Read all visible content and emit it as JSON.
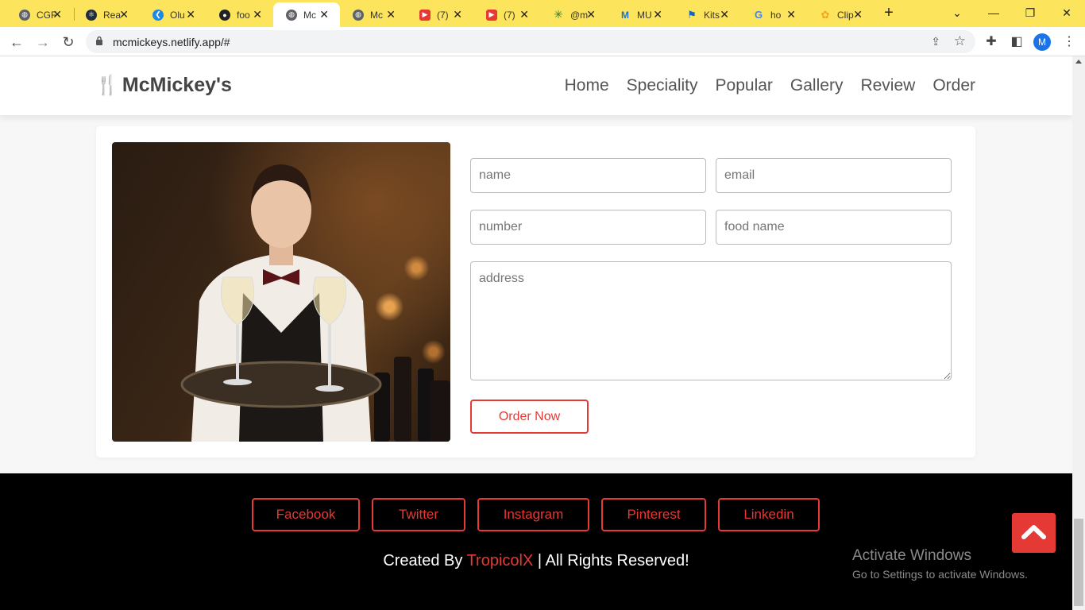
{
  "browser": {
    "tabs": [
      {
        "title": "CGF",
        "icon": "globe-icon",
        "color": "#5f6368"
      },
      {
        "title": "Rea",
        "icon": "react-icon",
        "color": "#222f3e"
      },
      {
        "title": "Olu",
        "icon": "vscode-icon",
        "color": "#1e88e5"
      },
      {
        "title": "foo",
        "icon": "github-icon",
        "color": "#222"
      },
      {
        "title": "Mc",
        "icon": "globe-icon",
        "color": "#5f6368",
        "active": true
      },
      {
        "title": "Mc",
        "icon": "globe-icon",
        "color": "#5f6368"
      },
      {
        "title": "(7)",
        "icon": "youtube-icon",
        "color": "#e53935"
      },
      {
        "title": "(7)",
        "icon": "youtube-icon",
        "color": "#e53935"
      },
      {
        "title": "@m",
        "icon": "asterisk-icon",
        "color": "#2e7d32"
      },
      {
        "title": "MU",
        "icon": "mui-icon",
        "color": "#1976d2"
      },
      {
        "title": "Kits",
        "icon": "flag-icon",
        "color": "#1565c0"
      },
      {
        "title": "ho",
        "icon": "google-icon",
        "color": "#4285f4"
      },
      {
        "title": "Clip",
        "icon": "clipchamp-icon",
        "color": "#f4a21d"
      }
    ],
    "url": "mcmickeys.netlify.app/#",
    "profile_initial": "M"
  },
  "site": {
    "brand": "McMickey's",
    "nav": [
      "Home",
      "Speciality",
      "Popular",
      "Gallery",
      "Review",
      "Order"
    ]
  },
  "order_form": {
    "name_placeholder": "name",
    "email_placeholder": "email",
    "number_placeholder": "number",
    "food_placeholder": "food name",
    "address_placeholder": "address",
    "submit_label": "Order Now"
  },
  "footer": {
    "social": [
      "Facebook",
      "Twitter",
      "Instagram",
      "Pinterest",
      "Linkedin"
    ],
    "credit_prefix": "Created By ",
    "credit_brand": "TropicolX",
    "credit_suffix": " | All Rights Reserved!"
  },
  "watermark": {
    "line1": "Activate Windows",
    "line2": "Go to Settings to activate Windows."
  },
  "colors": {
    "accent": "#e53935",
    "tabbar": "#fce45c"
  }
}
